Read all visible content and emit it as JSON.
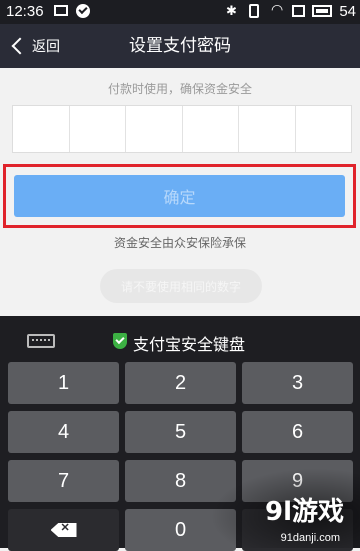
{
  "status_bar": {
    "time": "12:36",
    "battery": "54"
  },
  "nav": {
    "back_label": "返回",
    "title": "设置支付密码"
  },
  "hint": "付款时使用，确保资金安全",
  "pin_box_count": 6,
  "confirm_label": "确定",
  "safety_note": "资金安全由众安保险承保",
  "toast": "请不要使用相同的数字",
  "keyboard": {
    "title": "支付宝安全键盘",
    "keys": [
      "1",
      "2",
      "3",
      "4",
      "5",
      "6",
      "7",
      "8",
      "9",
      "0"
    ]
  },
  "colors": {
    "accent_blue": "#6aaef5",
    "highlight_red": "#e0232b",
    "shield_green": "#3cb043"
  },
  "watermark": {
    "text": "9l游戏",
    "url": "91danji.com"
  }
}
